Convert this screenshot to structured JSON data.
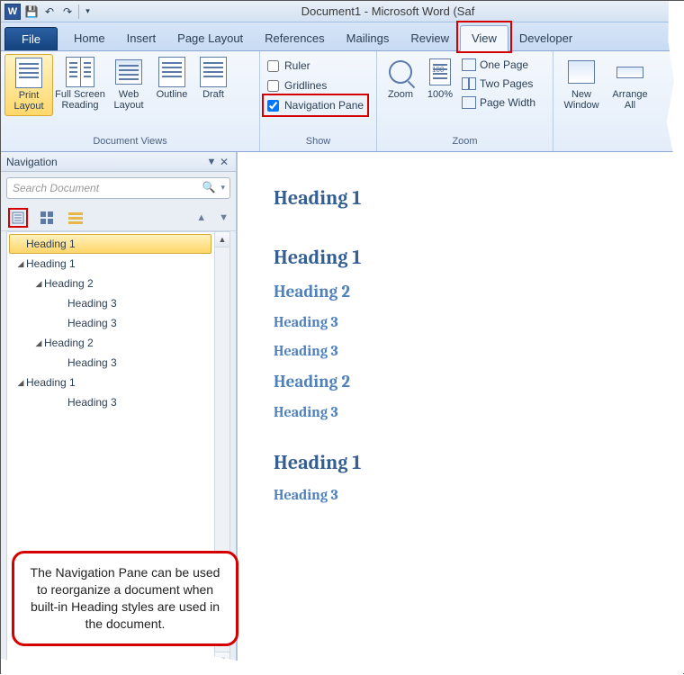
{
  "title": "Document1 - Microsoft Word (Saf",
  "tabs": {
    "file": "File",
    "items": [
      "Home",
      "Insert",
      "Page Layout",
      "References",
      "Mailings",
      "Review",
      "View",
      "Developer"
    ],
    "active": "View"
  },
  "ribbon": {
    "document_views": {
      "label": "Document Views",
      "print_layout": "Print Layout",
      "full_screen_reading": "Full Screen Reading",
      "web_layout": "Web Layout",
      "outline": "Outline",
      "draft": "Draft"
    },
    "show": {
      "label": "Show",
      "ruler": {
        "label": "Ruler",
        "checked": false
      },
      "gridlines": {
        "label": "Gridlines",
        "checked": false
      },
      "navigation_pane": {
        "label": "Navigation Pane",
        "checked": true
      }
    },
    "zoom": {
      "label": "Zoom",
      "zoom": "Zoom",
      "hundred": "100%",
      "one_page": "One Page",
      "two_pages": "Two Pages",
      "page_width": "Page Width"
    },
    "window": {
      "new_window": "New Window",
      "arrange_all": "Arrange All"
    }
  },
  "navpane": {
    "title": "Navigation",
    "search_placeholder": "Search Document",
    "tree": [
      {
        "level": 1,
        "label": "Heading 1",
        "expander": "",
        "selected": true
      },
      {
        "level": 1,
        "label": "Heading 1",
        "expander": "◢"
      },
      {
        "level": 2,
        "label": "Heading 2",
        "expander": "◢"
      },
      {
        "level": 3,
        "label": "Heading 3",
        "expander": ""
      },
      {
        "level": 3,
        "label": "Heading 3",
        "expander": ""
      },
      {
        "level": 2,
        "label": "Heading 2",
        "expander": "◢"
      },
      {
        "level": 3,
        "label": "Heading 3",
        "expander": ""
      },
      {
        "level": 1,
        "label": "Heading 1",
        "expander": "◢"
      },
      {
        "level": 3,
        "label": "Heading 3",
        "expander": ""
      }
    ]
  },
  "document": {
    "headings": [
      {
        "level": 1,
        "text": "Heading 1"
      },
      {
        "level": 1,
        "text": "Heading 1"
      },
      {
        "level": 2,
        "text": "Heading 2"
      },
      {
        "level": 3,
        "text": "Heading 3"
      },
      {
        "level": 3,
        "text": "Heading 3"
      },
      {
        "level": 2,
        "text": "Heading 2"
      },
      {
        "level": 3,
        "text": "Heading 3"
      },
      {
        "level": 1,
        "text": "Heading 1"
      },
      {
        "level": 3,
        "text": "Heading 3"
      }
    ]
  },
  "callout": "The Navigation Pane can be used to reorganize a document when built-in Heading styles are used in the document."
}
